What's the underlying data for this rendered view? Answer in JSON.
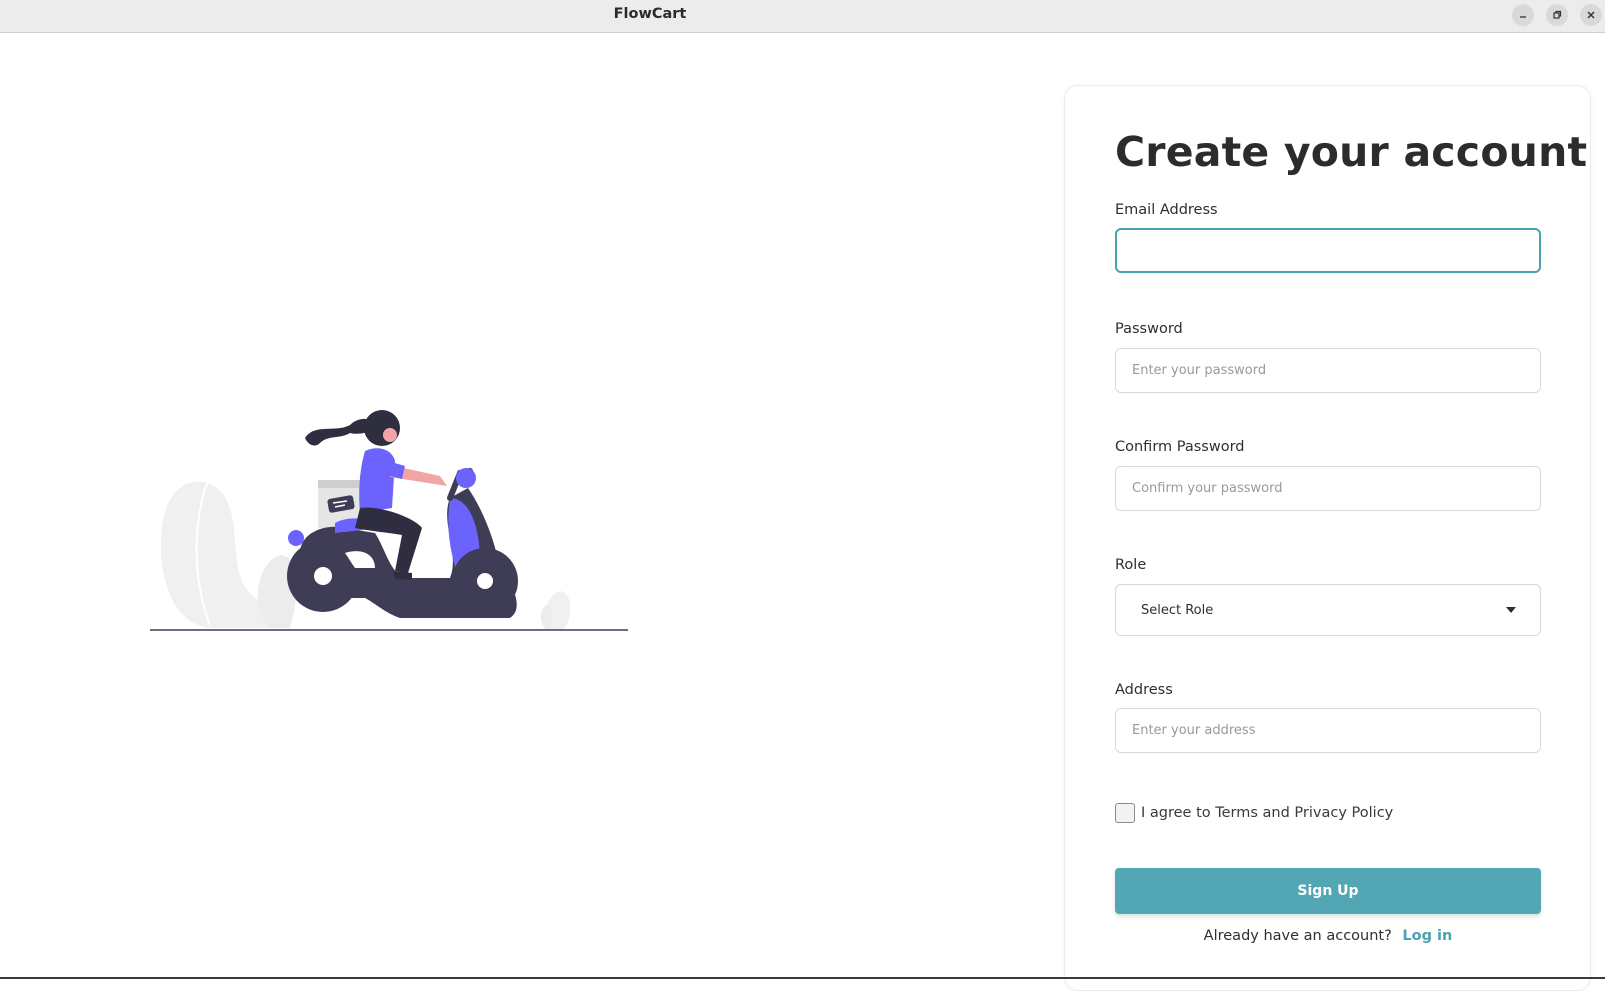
{
  "window": {
    "title": "FlowCart",
    "controls": [
      "minimize-icon",
      "restore-icon",
      "close-icon"
    ]
  },
  "illustration": {
    "name": "scooter-delivery-illustration",
    "colors": {
      "accent": "#6c63ff",
      "dark": "#3f3d56",
      "skin": "#f2a5a5",
      "plant": "#f0f0f0"
    }
  },
  "form": {
    "title": "Create your account",
    "email": {
      "label": "Email Address",
      "value": "",
      "placeholder": ""
    },
    "password": {
      "label": "Password",
      "value": "",
      "placeholder": "Enter your password"
    },
    "confirm_password": {
      "label": "Confirm Password",
      "value": "",
      "placeholder": "Confirm your password"
    },
    "role": {
      "label": "Role",
      "selected": "Select Role",
      "caret_icon": "caret-down-icon"
    },
    "address": {
      "label": "Address",
      "value": "",
      "placeholder": "Enter your address"
    },
    "agree": {
      "label": "I agree to Terms and Privacy Policy",
      "checked": false
    },
    "submit_label": "Sign Up",
    "login_prompt": "Already have an account?",
    "login_link": "Log in"
  },
  "colors": {
    "primary": "#53a6b3",
    "link": "#4aa3b0",
    "focus_border": "#4aa3b0",
    "text": "#2f2f2f"
  }
}
